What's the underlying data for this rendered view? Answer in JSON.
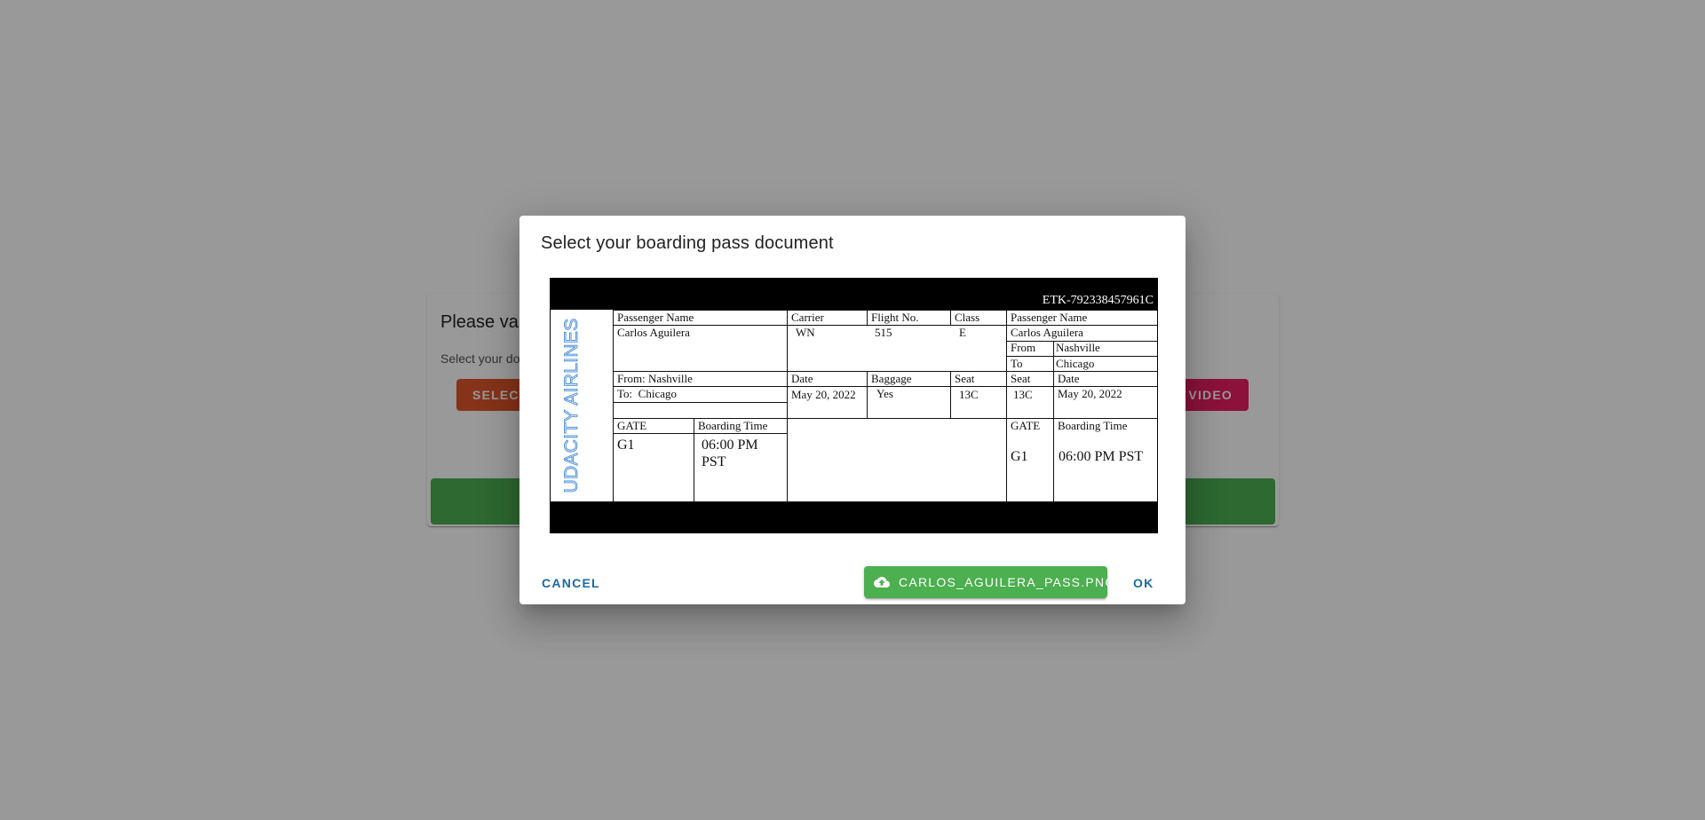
{
  "background": {
    "card_title": "Please va",
    "card_subtitle": "Select your do",
    "select_button_label": "SELECT",
    "video_button_label": "VIDEO"
  },
  "dialog": {
    "title": "Select your boarding pass document",
    "cancel_label": "CANCEL",
    "file_button_label": "CARLOS_AGUILERA_PASS.PNG",
    "file_button_icon": "cloud-upload-icon",
    "ok_label": "OK",
    "accent_color": "#1a6aa0",
    "file_button_color": "#4caf50"
  },
  "boarding_pass": {
    "ticket_number": "ETK-792338457961C",
    "airline_logo_text": "UDACITY AIRLINES",
    "labels": {
      "passenger_name": "Passenger Name",
      "carrier": "Carrier",
      "flight_no": "Flight No.",
      "class": "Class",
      "from": "From:",
      "to": "To:",
      "date": "Date",
      "baggage": "Baggage",
      "seat": "Seat",
      "gate": "GATE",
      "boarding_time": "Boarding Time",
      "stub_from": "From",
      "stub_to": "To"
    },
    "passenger_name": "Carlos Aguilera",
    "carrier": "WN",
    "flight_no": "515",
    "class": "E",
    "from": "Nashville",
    "to": "Chicago",
    "date": "May 20, 2022",
    "baggage": "Yes",
    "seat": "13C",
    "gate": "G1",
    "boarding_time_line1": "06:00 PM",
    "boarding_time_line2": "PST",
    "boarding_time": "06:00 PM PST"
  }
}
